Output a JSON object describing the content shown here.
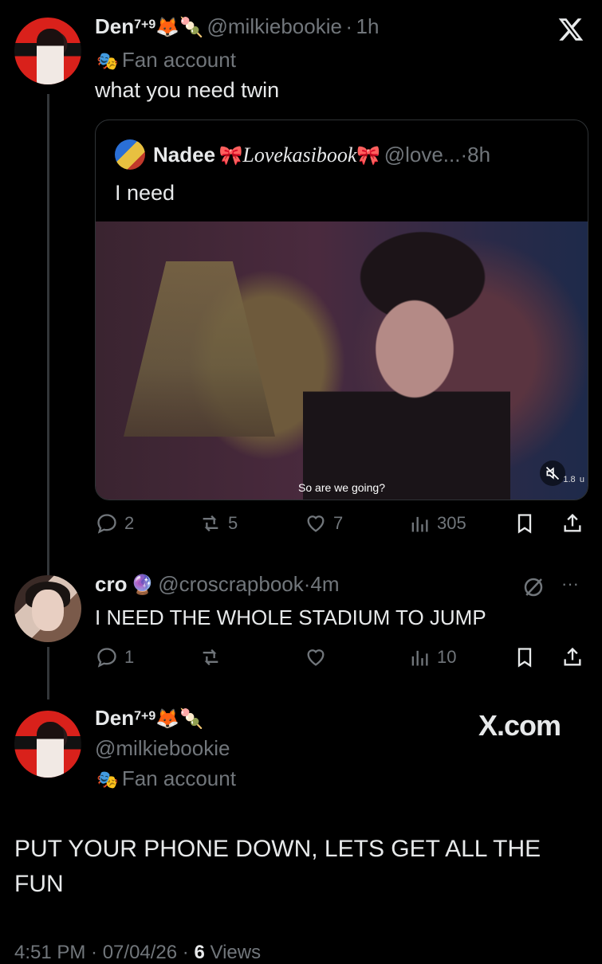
{
  "post1": {
    "display_name": "Den",
    "superscript": "7+9",
    "emoji": "🦊🍡",
    "handle": "@milkiebookie",
    "sep": "·",
    "time": "1h",
    "label_icon": "🎭",
    "label": "Fan account",
    "text": "what you need twin"
  },
  "quote": {
    "name": "Nadee",
    "bow1": "🎀",
    "styled_name": "Lovekasibook",
    "bow2": "🎀",
    "handle": "@love...",
    "sep": "·",
    "time": "8h",
    "text": "I need",
    "video_caption": "So are we going?",
    "video_views": "1.8  u"
  },
  "post1_actions": {
    "replies": "2",
    "reposts": "5",
    "likes": "7",
    "views": "305"
  },
  "post2": {
    "display_name": "cro",
    "emoji": "🔮",
    "handle": "@croscrapbook",
    "sep": "·",
    "time": "4m",
    "text": "I NEED THE WHOLE STADIUM TO JUMP",
    "more": "···"
  },
  "post2_actions": {
    "replies": "1",
    "reposts": "",
    "likes": "",
    "views": "10"
  },
  "post3": {
    "display_name": "Den",
    "superscript": "7+9",
    "emoji": "🦊🍡",
    "handle": "@milkiebookie",
    "label_icon": "🎭",
    "label": "Fan account",
    "text": "PUT YOUR PHONE DOWN, LETS GET ALL THE FUN",
    "meta": "4:51 PM · 07/04/26 · ",
    "views_count": "6",
    "views_label": " Views"
  },
  "watermark": "X.com"
}
